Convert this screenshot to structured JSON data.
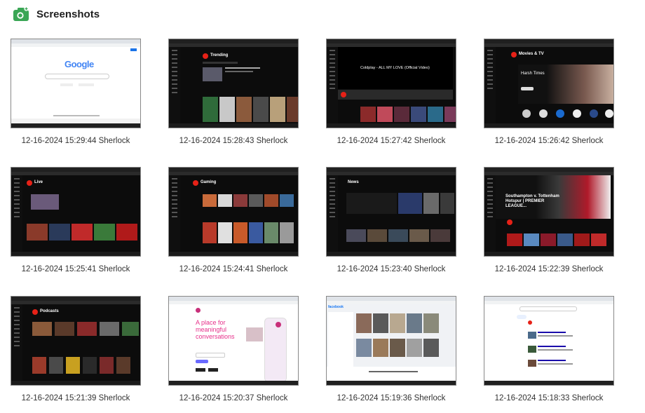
{
  "header": {
    "title": "Screenshots",
    "icon": "camera-icon"
  },
  "screenshots": [
    {
      "caption": "12-16-2024 15:29:44 Sherlock"
    },
    {
      "caption": "12-16-2024 15:28:43 Sherlock"
    },
    {
      "caption": "12-16-2024 15:27:42 Sherlock"
    },
    {
      "caption": "12-16-2024 15:26:42 Sherlock"
    },
    {
      "caption": "12-16-2024 15:25:41 Sherlock"
    },
    {
      "caption": "12-16-2024 15:24:41 Sherlock"
    },
    {
      "caption": "12-16-2024 15:23:40 Sherlock"
    },
    {
      "caption": "12-16-2024 15:22:39 Sherlock"
    },
    {
      "caption": "12-16-2024 15:21:39 Sherlock"
    },
    {
      "caption": "12-16-2024 15:20:37 Sherlock"
    },
    {
      "caption": "12-16-2024 15:19:36 Sherlock"
    },
    {
      "caption": "12-16-2024 15:18:33 Sherlock"
    }
  ],
  "thumbnail_text": {
    "google_logo": "Google",
    "trending": "Trending",
    "coldplay_title": "Coldplay - ALL MY LOVE (Official Video)",
    "movies_tv": "Movies & TV",
    "harsh_times": "Harsh Times",
    "live": "Live",
    "gaming": "Gaming",
    "news": "News",
    "southampton": "Southampton v. Tottenham Hotspur | PREMIER LEAGUE...",
    "podcasts": "Podcasts",
    "threads_headline": "A place for meaningful conversations",
    "facebook": "facebook"
  },
  "colors": {
    "accent_green": "#3aa655",
    "yt_red": "#e62117",
    "fb_blue": "#1877f2"
  }
}
